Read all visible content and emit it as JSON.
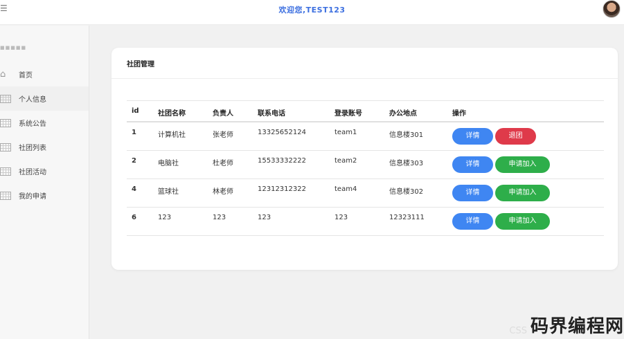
{
  "header": {
    "welcome": "欢迎您,TEST123",
    "menu_icon": "menu-icon",
    "avatar_icon": "user-avatar"
  },
  "sidebar": {
    "brand": "■■■■■",
    "items": [
      {
        "label": "首页",
        "icon": "home-icon"
      },
      {
        "label": "个人信息",
        "icon": "grid-icon"
      },
      {
        "label": "系统公告",
        "icon": "grid-icon"
      },
      {
        "label": "社团列表",
        "icon": "grid-icon"
      },
      {
        "label": "社团活动",
        "icon": "grid-icon"
      },
      {
        "label": "我的申请",
        "icon": "grid-icon"
      }
    ]
  },
  "main": {
    "title": "社团管理",
    "columns": [
      "id",
      "社团名称",
      "负责人",
      "联系电话",
      "登录账号",
      "办公地点",
      "操作"
    ],
    "rows": [
      {
        "id": "1",
        "name": "计算机社",
        "leader": "张老师",
        "phone": "13325652124",
        "account": "team1",
        "location": "信息楼301",
        "detail": "详情",
        "action": "退团",
        "action_type": "danger"
      },
      {
        "id": "2",
        "name": "电脑社",
        "leader": "杜老师",
        "phone": "15533332222",
        "account": "team2",
        "location": "信息楼303",
        "detail": "详情",
        "action": "申请加入",
        "action_type": "success"
      },
      {
        "id": "4",
        "name": "篮球社",
        "leader": "林老师",
        "phone": "12312312322",
        "account": "team4",
        "location": "信息楼302",
        "detail": "详情",
        "action": "申请加入",
        "action_type": "success"
      },
      {
        "id": "6",
        "name": "123",
        "leader": "123",
        "phone": "123",
        "account": "123",
        "location": "12323111",
        "detail": "详情",
        "action": "申请加入",
        "action_type": "success"
      }
    ]
  },
  "watermark": {
    "text": "码界编程网",
    "faint": "CSS"
  },
  "colors": {
    "primary": "#3f86f2",
    "danger": "#df3a4a",
    "success": "#2eae4a",
    "welcome": "#3c6fe0"
  }
}
